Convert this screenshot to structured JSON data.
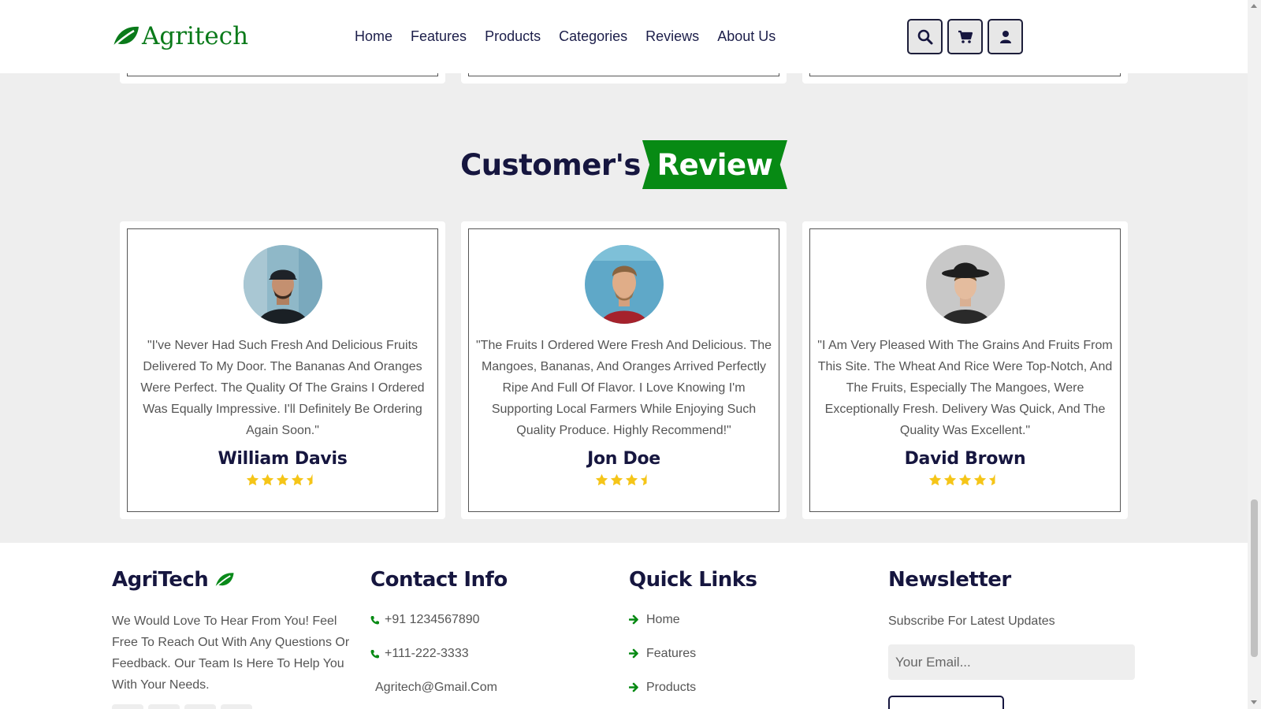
{
  "header": {
    "logo_text": "Agritech",
    "nav": [
      "Home",
      "Features",
      "Products",
      "Categories",
      "Reviews",
      "About Us"
    ],
    "icons": [
      "search-icon",
      "cart-icon",
      "user-icon"
    ]
  },
  "section": {
    "title_main": "Customer's",
    "title_highlight": "Review"
  },
  "reviews": [
    {
      "quote": "\"I've Never Had Such Fresh And Delicious Fruits Delivered To My Door. The Bananas And Oranges Were Perfect. The Quality Of The Grains I Ordered Was Equally Impressive. I'll Definitely Be Ordering Again Soon.\"",
      "name": "William Davis",
      "rating": 4.5
    },
    {
      "quote": "\"The Fruits I Ordered Were Fresh And Delicious. The Mangoes, Bananas, And Oranges Arrived Perfectly Ripe And Full Of Flavor. I Love Knowing I'm Supporting Local Farmers While Enjoying Such Quality Produce. Highly Recommend!\"",
      "name": "Jon Doe",
      "rating": 3.5
    },
    {
      "quote": "\"I Am Very Pleased With The Grains And Fruits From This Site. The Wheat And Rice Were Top-Notch, And The Fruits, Especially The Mangoes, Were Exceptionally Fresh. Delivery Was Quick, And The Quality Was Excellent.\"",
      "name": "David Brown",
      "rating": 4.5
    }
  ],
  "footer": {
    "brand": {
      "title": "AgriTech",
      "text": "We Would Love To Hear From You! Feel Free To Reach Out With Any Questions Or Feedback. Our Team Is Here To Help You With Your Needs."
    },
    "contact": {
      "title": "Contact Info",
      "phone1": "+91 1234567890",
      "phone2": "+111-222-3333",
      "email": "Agritech@Gmail.Com"
    },
    "links": {
      "title": "Quick Links",
      "items": [
        "Home",
        "Features",
        "Products"
      ]
    },
    "newsletter": {
      "title": "Newsletter",
      "subtitle": "Subscribe For Latest Updates",
      "placeholder": "Your Email..."
    }
  },
  "colors": {
    "accent": "#078a14",
    "navy": "#16163f",
    "star": "#f5c518"
  }
}
